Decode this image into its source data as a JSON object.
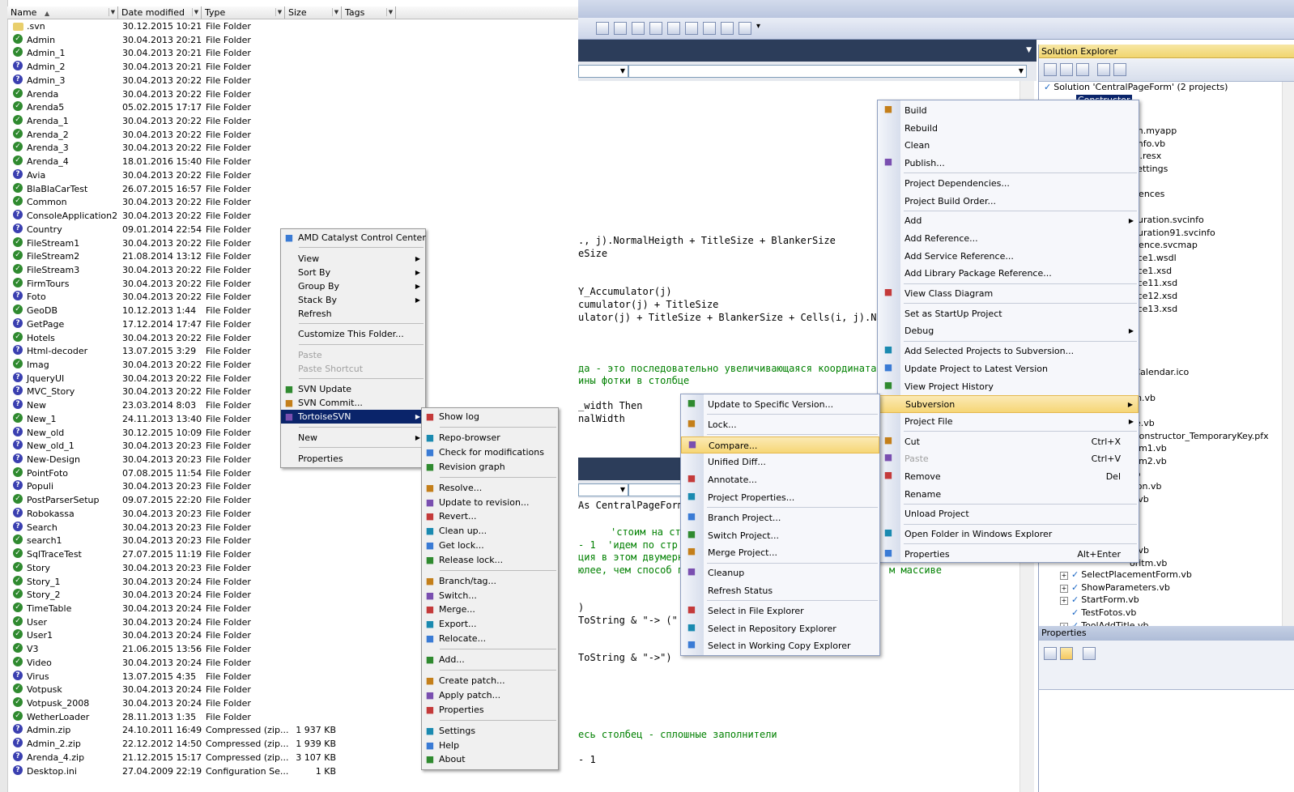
{
  "explorer": {
    "columns": {
      "name": "Name",
      "date": "Date modified",
      "type": "Type",
      "size": "Size",
      "tags": "Tags"
    },
    "rows": [
      {
        "name": ".svn",
        "date": "30.12.2015 10:21",
        "type": "File Folder",
        "size": ""
      },
      {
        "name": "Admin",
        "date": "30.04.2013 20:21",
        "type": "File Folder",
        "size": ""
      },
      {
        "name": "Admin_1",
        "date": "30.04.2013 20:21",
        "type": "File Folder",
        "size": ""
      },
      {
        "name": "Admin_2",
        "date": "30.04.2013 20:21",
        "type": "File Folder",
        "size": ""
      },
      {
        "name": "Admin_3",
        "date": "30.04.2013 20:22",
        "type": "File Folder",
        "size": ""
      },
      {
        "name": "Arenda",
        "date": "30.04.2013 20:22",
        "type": "File Folder",
        "size": ""
      },
      {
        "name": "Arenda5",
        "date": "05.02.2015 17:17",
        "type": "File Folder",
        "size": ""
      },
      {
        "name": "Arenda_1",
        "date": "30.04.2013 20:22",
        "type": "File Folder",
        "size": ""
      },
      {
        "name": "Arenda_2",
        "date": "30.04.2013 20:22",
        "type": "File Folder",
        "size": ""
      },
      {
        "name": "Arenda_3",
        "date": "30.04.2013 20:22",
        "type": "File Folder",
        "size": ""
      },
      {
        "name": "Arenda_4",
        "date": "18.01.2016 15:40",
        "type": "File Folder",
        "size": ""
      },
      {
        "name": "Avia",
        "date": "30.04.2013 20:22",
        "type": "File Folder",
        "size": ""
      },
      {
        "name": "BlaBlaCarTest",
        "date": "26.07.2015 16:57",
        "type": "File Folder",
        "size": ""
      },
      {
        "name": "Common",
        "date": "30.04.2013 20:22",
        "type": "File Folder",
        "size": ""
      },
      {
        "name": "ConsoleApplication2",
        "date": "30.04.2013 20:22",
        "type": "File Folder",
        "size": ""
      },
      {
        "name": "Country",
        "date": "09.01.2014 22:54",
        "type": "File Folder",
        "size": ""
      },
      {
        "name": "FileStream1",
        "date": "30.04.2013 20:22",
        "type": "File Folder",
        "size": ""
      },
      {
        "name": "FileStream2",
        "date": "21.08.2014 13:12",
        "type": "File Folder",
        "size": ""
      },
      {
        "name": "FileStream3",
        "date": "30.04.2013 20:22",
        "type": "File Folder",
        "size": ""
      },
      {
        "name": "FirmTours",
        "date": "30.04.2013 20:22",
        "type": "File Folder",
        "size": ""
      },
      {
        "name": "Foto",
        "date": "30.04.2013 20:22",
        "type": "File Folder",
        "size": ""
      },
      {
        "name": "GeoDB",
        "date": "10.12.2013 1:44",
        "type": "File Folder",
        "size": ""
      },
      {
        "name": "GetPage",
        "date": "17.12.2014 17:47",
        "type": "File Folder",
        "size": ""
      },
      {
        "name": "Hotels",
        "date": "30.04.2013 20:22",
        "type": "File Folder",
        "size": ""
      },
      {
        "name": "Html-decoder",
        "date": "13.07.2015 3:29",
        "type": "File Folder",
        "size": ""
      },
      {
        "name": "Imag",
        "date": "30.04.2013 20:22",
        "type": "File Folder",
        "size": ""
      },
      {
        "name": "JqueryUI",
        "date": "30.04.2013 20:22",
        "type": "File Folder",
        "size": ""
      },
      {
        "name": "MVC_Story",
        "date": "30.04.2013 20:22",
        "type": "File Folder",
        "size": ""
      },
      {
        "name": "New",
        "date": "23.03.2014 8:03",
        "type": "File Folder",
        "size": ""
      },
      {
        "name": "New_1",
        "date": "24.11.2013 13:40",
        "type": "File Folder",
        "size": ""
      },
      {
        "name": "New_old",
        "date": "30.12.2015 10:09",
        "type": "File Folder",
        "size": ""
      },
      {
        "name": "New_old_1",
        "date": "30.04.2013 20:23",
        "type": "File Folder",
        "size": ""
      },
      {
        "name": "New-Design",
        "date": "30.04.2013 20:23",
        "type": "File Folder",
        "size": ""
      },
      {
        "name": "PointFoto",
        "date": "07.08.2015 11:54",
        "type": "File Folder",
        "size": ""
      },
      {
        "name": "Populi",
        "date": "30.04.2013 20:23",
        "type": "File Folder",
        "size": ""
      },
      {
        "name": "PostParserSetup",
        "date": "09.07.2015 22:20",
        "type": "File Folder",
        "size": ""
      },
      {
        "name": "Robokassa",
        "date": "30.04.2013 20:23",
        "type": "File Folder",
        "size": ""
      },
      {
        "name": "Search",
        "date": "30.04.2013 20:23",
        "type": "File Folder",
        "size": ""
      },
      {
        "name": "search1",
        "date": "30.04.2013 20:23",
        "type": "File Folder",
        "size": ""
      },
      {
        "name": "SqlTraceTest",
        "date": "27.07.2015 11:19",
        "type": "File Folder",
        "size": ""
      },
      {
        "name": "Story",
        "date": "30.04.2013 20:23",
        "type": "File Folder",
        "size": ""
      },
      {
        "name": "Story_1",
        "date": "30.04.2013 20:24",
        "type": "File Folder",
        "size": ""
      },
      {
        "name": "Story_2",
        "date": "30.04.2013 20:24",
        "type": "File Folder",
        "size": ""
      },
      {
        "name": "TimeTable",
        "date": "30.04.2013 20:24",
        "type": "File Folder",
        "size": ""
      },
      {
        "name": "User",
        "date": "30.04.2013 20:24",
        "type": "File Folder",
        "size": ""
      },
      {
        "name": "User1",
        "date": "30.04.2013 20:24",
        "type": "File Folder",
        "size": ""
      },
      {
        "name": "V3",
        "date": "21.06.2015 13:56",
        "type": "File Folder",
        "size": ""
      },
      {
        "name": "Video",
        "date": "30.04.2013 20:24",
        "type": "File Folder",
        "size": ""
      },
      {
        "name": "Virus",
        "date": "13.07.2015 4:35",
        "type": "File Folder",
        "size": ""
      },
      {
        "name": "Votpusk",
        "date": "30.04.2013 20:24",
        "type": "File Folder",
        "size": ""
      },
      {
        "name": "Votpusk_2008",
        "date": "30.04.2013 20:24",
        "type": "File Folder",
        "size": ""
      },
      {
        "name": "WetherLoader",
        "date": "28.11.2013 1:35",
        "type": "File Folder",
        "size": ""
      },
      {
        "name": "Admin.zip",
        "date": "24.10.2011 16:49",
        "type": "Compressed (zip...",
        "size": "1 937 KB"
      },
      {
        "name": "Admin_2.zip",
        "date": "22.12.2012 14:50",
        "type": "Compressed (zip...",
        "size": "1 939 KB"
      },
      {
        "name": "Arenda_4.zip",
        "date": "21.12.2015 15:17",
        "type": "Compressed (zip...",
        "size": "3 107 KB"
      },
      {
        "name": "Desktop.ini",
        "date": "27.04.2009 22:19",
        "type": "Configuration Se...",
        "size": "1 KB"
      }
    ]
  },
  "explorer_menu": [
    {
      "label": "AMD Catalyst Control Center",
      "icon": "amd-icon"
    },
    {
      "sep": true
    },
    {
      "label": "View",
      "sub": true
    },
    {
      "label": "Sort By",
      "sub": true
    },
    {
      "label": "Group By",
      "sub": true
    },
    {
      "label": "Stack By",
      "sub": true
    },
    {
      "label": "Refresh"
    },
    {
      "sep": true
    },
    {
      "label": "Customize This Folder..."
    },
    {
      "sep": true
    },
    {
      "label": "Paste",
      "disabled": true
    },
    {
      "label": "Paste Shortcut",
      "disabled": true
    },
    {
      "sep": true
    },
    {
      "label": "SVN Update",
      "icon": "svn-update-icon"
    },
    {
      "label": "SVN Commit...",
      "icon": "svn-commit-icon"
    },
    {
      "label": "TortoiseSVN",
      "icon": "tortoise-icon",
      "sub": true,
      "highlight": true
    },
    {
      "sep": true
    },
    {
      "label": "New",
      "sub": true
    },
    {
      "sep": true
    },
    {
      "label": "Properties"
    }
  ],
  "tortoise_menu": [
    {
      "label": "Show log",
      "icon": "log-icon"
    },
    {
      "sep": true
    },
    {
      "label": "Repo-browser",
      "icon": "repo-icon"
    },
    {
      "label": "Check for modifications",
      "icon": "check-icon"
    },
    {
      "label": "Revision graph",
      "icon": "graph-icon"
    },
    {
      "sep": true
    },
    {
      "label": "Resolve...",
      "icon": "resolve-icon"
    },
    {
      "label": "Update to revision...",
      "icon": "update-icon"
    },
    {
      "label": "Revert...",
      "icon": "revert-icon"
    },
    {
      "label": "Clean up...",
      "icon": "cleanup-icon"
    },
    {
      "label": "Get lock...",
      "icon": "lock-icon"
    },
    {
      "label": "Release lock...",
      "icon": "unlock-icon"
    },
    {
      "sep": true
    },
    {
      "label": "Branch/tag...",
      "icon": "branch-icon"
    },
    {
      "label": "Switch...",
      "icon": "switch-icon"
    },
    {
      "label": "Merge...",
      "icon": "merge-icon"
    },
    {
      "label": "Export...",
      "icon": "export-icon"
    },
    {
      "label": "Relocate...",
      "icon": "relocate-icon"
    },
    {
      "sep": true
    },
    {
      "label": "Add...",
      "icon": "add-icon"
    },
    {
      "sep": true
    },
    {
      "label": "Create patch...",
      "icon": "patch-icon"
    },
    {
      "label": "Apply patch...",
      "icon": "apply-patch-icon"
    },
    {
      "label": "Properties",
      "icon": "properties-icon"
    },
    {
      "sep": true
    },
    {
      "label": "Settings",
      "icon": "settings-icon"
    },
    {
      "label": "Help",
      "icon": "help-icon"
    },
    {
      "label": "About",
      "icon": "about-icon"
    }
  ],
  "project_menu": [
    {
      "label": "Build",
      "icon": "build-icon"
    },
    {
      "label": "Rebuild"
    },
    {
      "label": "Clean"
    },
    {
      "label": "Publish...",
      "icon": "publish-icon"
    },
    {
      "sep": true
    },
    {
      "label": "Project Dependencies..."
    },
    {
      "label": "Project Build Order..."
    },
    {
      "sep": true
    },
    {
      "label": "Add",
      "sub": true
    },
    {
      "label": "Add Reference..."
    },
    {
      "label": "Add Service Reference..."
    },
    {
      "label": "Add Library Package Reference..."
    },
    {
      "sep": true
    },
    {
      "label": "View Class Diagram",
      "icon": "class-diagram-icon"
    },
    {
      "sep": true
    },
    {
      "label": "Set as StartUp Project"
    },
    {
      "label": "Debug",
      "sub": true
    },
    {
      "sep": true
    },
    {
      "label": "Add Selected Projects to Subversion...",
      "icon": "add-svn-icon"
    },
    {
      "label": "Update Project to Latest Version",
      "icon": "update-latest-icon"
    },
    {
      "label": "View Project History",
      "icon": "history-icon"
    },
    {
      "label": "Subversion",
      "sub": true,
      "highlight": true
    },
    {
      "label": "Project File",
      "sub": true
    },
    {
      "sep": true
    },
    {
      "label": "Cut",
      "icon": "cut-icon",
      "shortcut": "Ctrl+X"
    },
    {
      "label": "Paste",
      "icon": "paste-icon",
      "shortcut": "Ctrl+V",
      "disabled": true
    },
    {
      "label": "Remove",
      "icon": "remove-icon",
      "shortcut": "Del"
    },
    {
      "label": "Rename"
    },
    {
      "sep": true
    },
    {
      "label": "Unload Project"
    },
    {
      "sep": true
    },
    {
      "label": "Open Folder in Windows Explorer",
      "icon": "open-folder-icon"
    },
    {
      "sep": true
    },
    {
      "label": "Properties",
      "icon": "properties-icon",
      "shortcut": "Alt+Enter"
    }
  ],
  "subversion_menu": [
    {
      "label": "Update to Specific Version...",
      "icon": "update-version-icon"
    },
    {
      "sep": true
    },
    {
      "label": "Lock...",
      "icon": "lock-icon"
    },
    {
      "sep": true
    },
    {
      "label": "Compare...",
      "icon": "compare-icon",
      "highlight": true
    },
    {
      "label": "Unified Diff..."
    },
    {
      "label": "Annotate...",
      "icon": "annotate-icon"
    },
    {
      "label": "Project Properties...",
      "icon": "project-props-icon"
    },
    {
      "sep": true
    },
    {
      "label": "Branch Project...",
      "icon": "branch-icon"
    },
    {
      "label": "Switch Project...",
      "icon": "switch-icon"
    },
    {
      "label": "Merge Project...",
      "icon": "merge-icon"
    },
    {
      "sep": true
    },
    {
      "label": "Cleanup",
      "icon": "cleanup-icon"
    },
    {
      "label": "Refresh Status"
    },
    {
      "sep": true
    },
    {
      "label": "Select in File Explorer",
      "icon": "file-explorer-icon"
    },
    {
      "label": "Select in Repository Explorer",
      "icon": "repo-explorer-icon"
    },
    {
      "label": "Select in Working Copy Explorer",
      "icon": "wc-explorer-icon"
    }
  ],
  "solution_explorer": {
    "title": "Solution Explorer",
    "solution_label": "Solution 'CentralPageForm' (2 projects)",
    "selected_project": "Constructor",
    "partial_items": [
      "ion.myapp",
      "yInfo.vb",
      "es.resx",
      ".settings",
      "erences",
      "1",
      "iguration.svcinfo",
      "iguration91.svcinfo",
      "erence.svcmap",
      "vice1.wsdl",
      "vice1.xsd",
      "vice11.xsd",
      "vice12.xsd",
      "vice13.xsd",
      "_Calendar.ico",
      "rm.vb",
      "ge.vb",
      "-Constructor_TemporaryKey.pfx",
      "tem1.vb",
      "tem2.vb",
      "vb",
      "sion.vb",
      "e.vb",
      "b",
      "n.vb",
      "oritm.vb"
    ],
    "items": [
      "SelectPlacementForm.vb",
      "ShowParameters.vb",
      "StartForm.vb",
      "TestFotos.vb",
      "ToolAddTitle.vb"
    ]
  },
  "properties_panel": {
    "title": "Properties"
  },
  "code_top": [
    "., j).NormalHeigth + TitleSize + BlankerSize",
    "eSize",
    "",
    "",
    "Y_Accumulator(j)",
    "cumulator(j) + TitleSize",
    "ulator(j) + TitleSize + BlankerSize + Cells(i, j).Norm",
    "",
    "",
    "да - это последовательно увеличивающаяся координата X",
    "ины фотки в столбце",
    "",
    "_width Then",
    "nalWidth"
  ],
  "code_bottom": [
    "As CentralPageForm",
    "",
    "'стоим на ст",
    "- 1  'идем по стр",
    "ция в этом двумерно",
    "юлее, чем способ п",
    "м массиве",
    "",
    "",
    ")",
    "ToString & \"-> (\"",
    "",
    "",
    "ToString & \"->\")",
    "",
    "",
    "",
    "",
    "",
    "есь столбец - сплошные заполнители",
    "",
    "- 1"
  ]
}
